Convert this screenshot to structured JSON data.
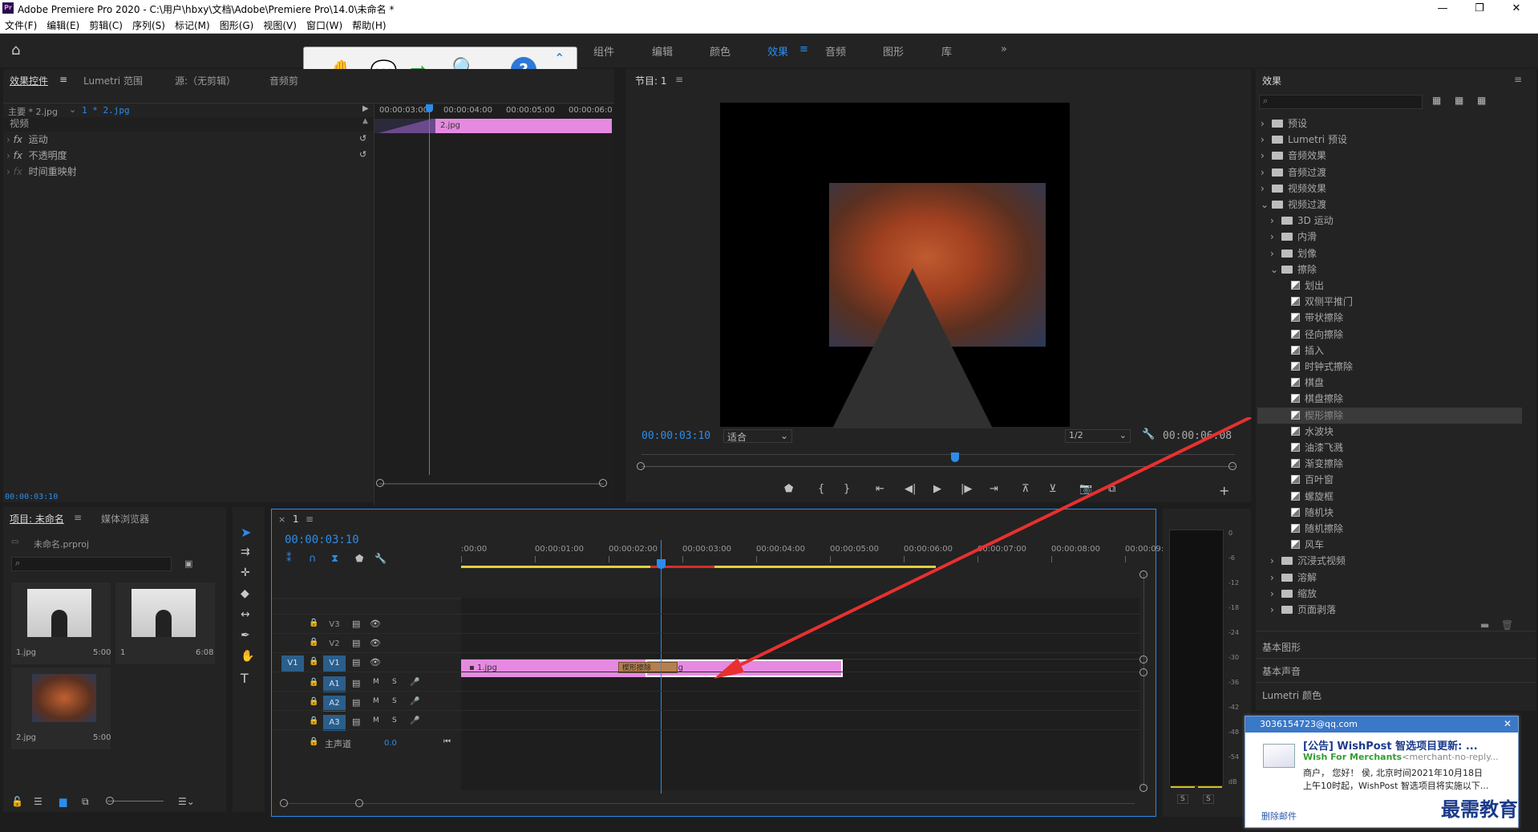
{
  "window": {
    "title": "Adobe Premiere Pro 2020 - C:\\用户\\hbxy\\文档\\Adobe\\Premiere Pro\\14.0\\未命名 *",
    "logo": "Pr"
  },
  "menu": [
    "文件(F)",
    "编辑(E)",
    "剪辑(C)",
    "序列(S)",
    "标记(M)",
    "图形(G)",
    "视图(V)",
    "窗口(W)",
    "帮助(H)"
  ],
  "workspaces": [
    "组件",
    "编辑",
    "颜色",
    "效果",
    "音频",
    "图形",
    "库"
  ],
  "effect_controls": {
    "tabs": [
      "效果控件",
      "Lumetri 范围",
      "源:（无剪辑）",
      "音频剪"
    ],
    "master": "主要 * 2.jpg",
    "sequence": "1 * 2.jpg",
    "ruler": [
      "00:00:03:00",
      "00:00:04:00",
      "00:00:05:00",
      "00:00:06:0"
    ],
    "clip": "2.jpg",
    "section": "视频",
    "items": [
      "运动",
      "不透明度",
      "时间重映射"
    ],
    "timecode": "00:00:03:10"
  },
  "program": {
    "title": "节目: 1",
    "timecode": "00:00:03:10",
    "fit": "适合",
    "quality": "1/2",
    "duration": "00:00:06:08"
  },
  "project": {
    "tabs": [
      "项目: 未命名",
      "媒体浏览器"
    ],
    "file": "未命名.prproj",
    "items": [
      {
        "name": "1.jpg",
        "dur": "5:00"
      },
      {
        "name": "1",
        "dur": "6:08"
      },
      {
        "name": "2.jpg",
        "dur": "5:00"
      }
    ]
  },
  "timeline": {
    "tab": "1",
    "timecode": "00:00:03:10",
    "ruler": [
      ":00:00",
      "00:00:01:00",
      "00:00:02:00",
      "00:00:03:00",
      "00:00:04:00",
      "00:00:05:00",
      "00:00:06:00",
      "00:00:07:00",
      "00:00:08:00",
      "00:00:09:"
    ],
    "video_tracks": [
      "V3",
      "V2",
      "V1"
    ],
    "audio_tracks": [
      "A1",
      "A2",
      "A3"
    ],
    "master": "主声道",
    "master_val": "0.0",
    "clip1": "1.jpg",
    "clip2": "2.jpg",
    "transition": "楔形擦除",
    "v1src": "V1",
    "btn_m": "M",
    "btn_s": "S"
  },
  "meter": {
    "scale": [
      "0",
      "-6",
      "-12",
      "-18",
      "-24",
      "-30",
      "-36",
      "-42",
      "-48",
      "-54",
      "dB"
    ],
    "solo": "S"
  },
  "effects": {
    "title": "效果",
    "tree": [
      {
        "l": 0,
        "t": "预设",
        "k": "bin"
      },
      {
        "l": 0,
        "t": "Lumetri 预设",
        "k": "bin"
      },
      {
        "l": 0,
        "t": "音频效果",
        "k": "f"
      },
      {
        "l": 0,
        "t": "音频过渡",
        "k": "f"
      },
      {
        "l": 0,
        "t": "视频效果",
        "k": "f"
      },
      {
        "l": 0,
        "t": "视频过渡",
        "k": "f",
        "open": true
      },
      {
        "l": 1,
        "t": "3D 运动",
        "k": "f"
      },
      {
        "l": 1,
        "t": "内滑",
        "k": "f"
      },
      {
        "l": 1,
        "t": "划像",
        "k": "f"
      },
      {
        "l": 1,
        "t": "擦除",
        "k": "f",
        "open": true
      },
      {
        "l": 2,
        "t": "划出",
        "k": "fx"
      },
      {
        "l": 2,
        "t": "双侧平推门",
        "k": "fx"
      },
      {
        "l": 2,
        "t": "带状擦除",
        "k": "fx"
      },
      {
        "l": 2,
        "t": "径向擦除",
        "k": "fx"
      },
      {
        "l": 2,
        "t": "插入",
        "k": "fx"
      },
      {
        "l": 2,
        "t": "时钟式擦除",
        "k": "fx"
      },
      {
        "l": 2,
        "t": "棋盘",
        "k": "fx"
      },
      {
        "l": 2,
        "t": "棋盘擦除",
        "k": "fx"
      },
      {
        "l": 2,
        "t": "楔形擦除",
        "k": "fx",
        "sel": true
      },
      {
        "l": 2,
        "t": "水波块",
        "k": "fx"
      },
      {
        "l": 2,
        "t": "油漆飞溅",
        "k": "fx"
      },
      {
        "l": 2,
        "t": "渐变擦除",
        "k": "fx"
      },
      {
        "l": 2,
        "t": "百叶窗",
        "k": "fx"
      },
      {
        "l": 2,
        "t": "螺旋框",
        "k": "fx"
      },
      {
        "l": 2,
        "t": "随机块",
        "k": "fx"
      },
      {
        "l": 2,
        "t": "随机擦除",
        "k": "fx"
      },
      {
        "l": 2,
        "t": "风车",
        "k": "fx"
      },
      {
        "l": 1,
        "t": "沉浸式视频",
        "k": "f"
      },
      {
        "l": 1,
        "t": "溶解",
        "k": "f"
      },
      {
        "l": 1,
        "t": "缩放",
        "k": "f"
      },
      {
        "l": 1,
        "t": "页面剥落",
        "k": "f"
      }
    ],
    "sections": [
      "基本图形",
      "基本声音",
      "Lumetri 颜色"
    ]
  },
  "notification": {
    "from": "3036154723@qq.com",
    "subject": "[公告] WishPost 智选项目更新: ...",
    "sender": "Wish For Merchants",
    "sender_mail": "<merchant-no-reply...",
    "line1": "商户，  您好！  侯, 北京时间2021年10月18日",
    "line2": "上午10时起，WishPost 智选项目将实施以下...",
    "delete": "删除邮件",
    "watermark": "最需教育"
  }
}
